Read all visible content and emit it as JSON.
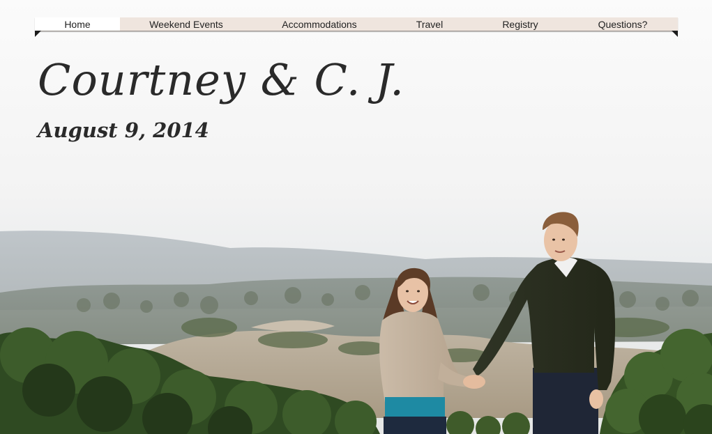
{
  "nav": {
    "items": [
      {
        "label": "Home",
        "active": true
      },
      {
        "label": "Weekend Events",
        "active": false
      },
      {
        "label": "Accommodations",
        "active": false
      },
      {
        "label": "Travel",
        "active": false
      },
      {
        "label": "Registry",
        "active": false
      },
      {
        "label": "Questions?",
        "active": false
      }
    ]
  },
  "hero": {
    "names": "Courtney & C. J.",
    "date": "August 9, 2014"
  },
  "colors": {
    "nav_background": "#efe5de",
    "nav_active": "#ffffff",
    "text": "#2a2a2a"
  }
}
